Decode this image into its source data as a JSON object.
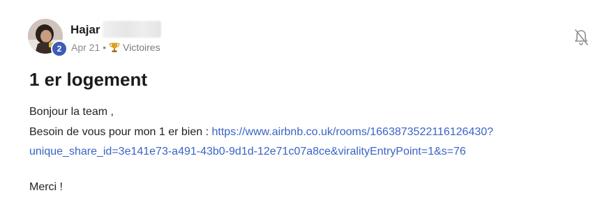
{
  "post": {
    "author": {
      "name": "Hajar",
      "level": "2"
    },
    "meta": {
      "date": "Apr 21",
      "separator": "•",
      "category": "Victoires"
    },
    "title": "1 er logement",
    "body": {
      "greeting": "Bonjour la team ,",
      "request_prefix": "Besoin de vous pour mon 1 er bien : ",
      "link_part1": "https://www.airbnb.co.uk/rooms/1663873522116126430?",
      "link_part2": "unique_share_id=3e141e73-a491-43b0-9d1d-12e71c07a8ce&viralityEntryPoint=1&s=76",
      "closing": "Merci !"
    },
    "icons": {
      "notification": "bell-off-icon",
      "category": "trophy-icon"
    },
    "colors": {
      "link": "#3a63c7",
      "level_badge": "#3f5bb8",
      "meta_text": "#8a8a8a"
    }
  }
}
